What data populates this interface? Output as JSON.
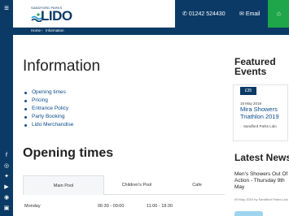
{
  "header": {
    "logo_small": "SANDFORD PARKS",
    "logo_big": "LIDO",
    "phone": "01242 524430",
    "email_label": "Email"
  },
  "breadcrumb": [
    "Home",
    "Information"
  ],
  "main": {
    "title": "Information",
    "links": [
      "Opening times",
      "Pricing",
      "Entrance Policy",
      "Party Booking",
      "Lido Merchandise"
    ],
    "opening": {
      "title": "Opening times",
      "tabs": [
        "Main Pool",
        "Children's Pool",
        "Cafe"
      ],
      "active_tab": "Main Pool",
      "row": {
        "day": "Monday",
        "slot1": "06:30 - 09:00",
        "slot2": "11:00 - 18:30"
      }
    }
  },
  "sidebar": {
    "featured_title": "Featured Events",
    "event": {
      "price": "£35",
      "date": "18 May 2019",
      "name": "Mira Showers Triathlon 2019",
      "location": "Sandford Parks Lido"
    },
    "news_title": "Latest News",
    "news": {
      "headline": "Men's Showers Out Of Action - Thursday 9th May",
      "date": "09 May 2019",
      "by": "by",
      "source": "Sandford Parks Lido"
    }
  },
  "icons": {
    "menu": "hamburger-menu-icon",
    "phone": "phone-icon",
    "email": "envelope-icon",
    "social": [
      "facebook-icon",
      "instagram-icon",
      "twitter-icon",
      "youtube-icon",
      "tripadvisor-icon",
      "linkedin-icon"
    ]
  },
  "colors": {
    "navy": "#0b3a66",
    "green": "#1fa64a",
    "link": "#0b4c8c"
  }
}
